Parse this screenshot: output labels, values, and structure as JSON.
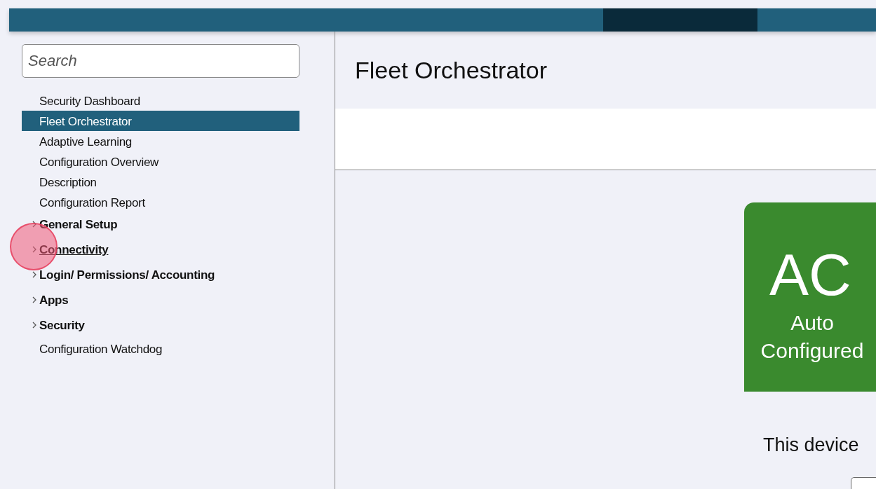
{
  "search": {
    "placeholder": "Search"
  },
  "nav": [
    {
      "kind": "leaf",
      "label": "Security Dashboard",
      "selected": false,
      "hovered": false
    },
    {
      "kind": "leaf",
      "label": "Fleet Orchestrator",
      "selected": true,
      "hovered": false
    },
    {
      "kind": "leaf",
      "label": "Adaptive Learning",
      "selected": false,
      "hovered": false
    },
    {
      "kind": "leaf",
      "label": "Configuration Overview",
      "selected": false,
      "hovered": false
    },
    {
      "kind": "leaf",
      "label": "Description",
      "selected": false,
      "hovered": false
    },
    {
      "kind": "leaf",
      "label": "Configuration Report",
      "selected": false,
      "hovered": false
    },
    {
      "kind": "group",
      "label": "General Setup",
      "selected": false,
      "hovered": false,
      "expanded": false
    },
    {
      "kind": "group",
      "label": "Connectivity",
      "selected": false,
      "hovered": true,
      "expanded": false
    },
    {
      "kind": "group",
      "label": "Login/ Permissions/ Accounting",
      "selected": false,
      "hovered": false,
      "expanded": false
    },
    {
      "kind": "group",
      "label": "Apps",
      "selected": false,
      "hovered": false,
      "expanded": false
    },
    {
      "kind": "group",
      "label": "Security",
      "selected": false,
      "hovered": false,
      "expanded": false
    },
    {
      "kind": "leaf",
      "label": "Configuration Watchdog",
      "selected": false,
      "hovered": false
    }
  ],
  "page": {
    "title": "Fleet Orchestrator"
  },
  "status_badge": {
    "code": "AC",
    "label": "Auto Configured",
    "color": "#3a8a2e"
  },
  "message": "This device"
}
